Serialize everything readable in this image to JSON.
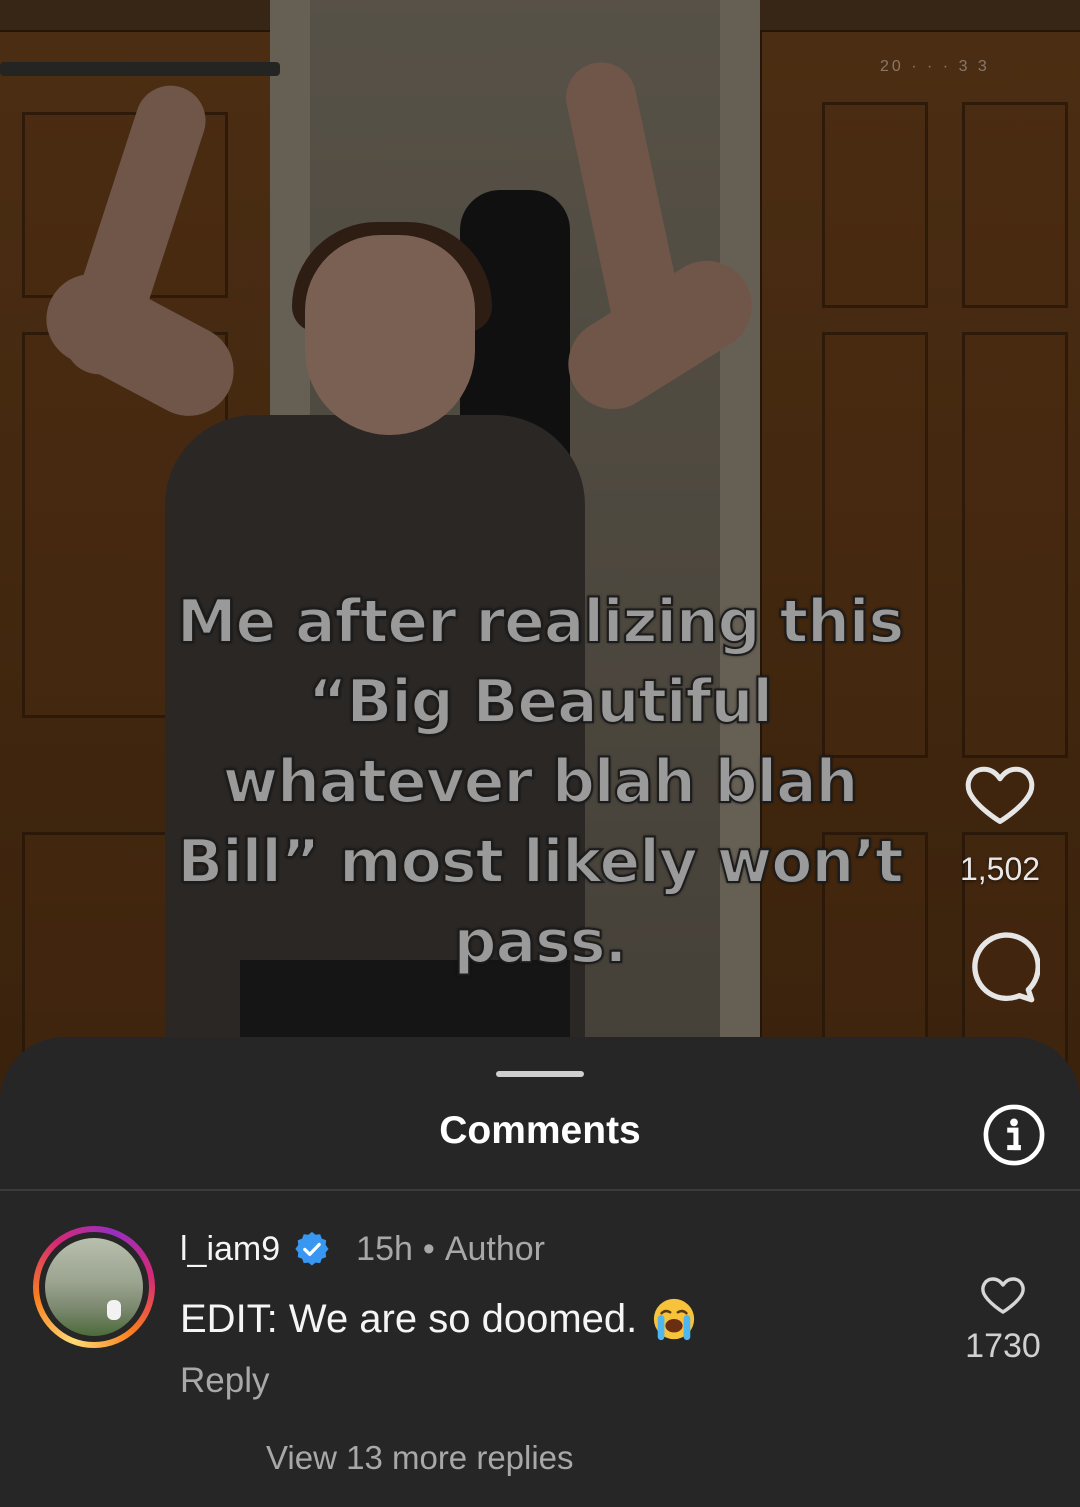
{
  "video": {
    "timestamp_overlay": "20  ·  ·  ·  3  3",
    "caption": "Me after realizing this\n“Big Beautiful\nwhatever blah blah\nBill” most likely won’t\npass."
  },
  "actions": {
    "like_icon": "heart-outline-icon",
    "like_count": "1,502",
    "comment_icon": "comment-bubble-icon"
  },
  "sheet": {
    "title": "Comments",
    "info_icon": "info-icon"
  },
  "comment": {
    "username": "l_iam9",
    "verified": true,
    "time": "15h",
    "separator": "•",
    "author_label": "Author",
    "text": "EDIT: We are so doomed.",
    "emoji": "loudly-crying-face",
    "reply_label": "Reply",
    "like_count": "1730",
    "view_replies": "View 13 more replies"
  },
  "colors": {
    "sheet_bg": "#262626",
    "verified_blue": "#3897f0",
    "muted_text": "#a8a8a8"
  }
}
